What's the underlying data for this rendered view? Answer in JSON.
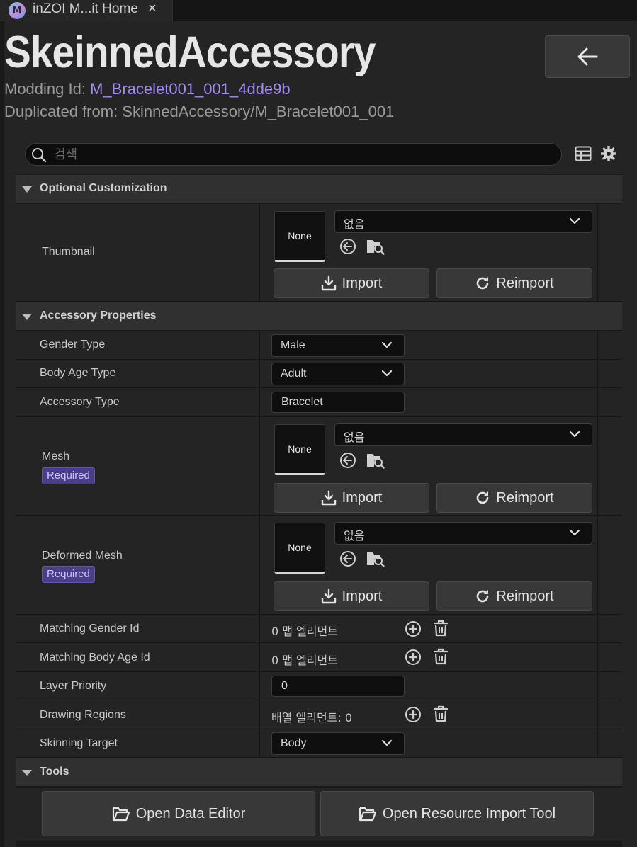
{
  "tab": {
    "title": "inZOI M...it Home",
    "close": "×",
    "logo": "M"
  },
  "header": {
    "title": "SkeinnedAccessory",
    "modding_id_label": "Modding Id: ",
    "modding_id_value": "M_Bracelet001_001_4dde9b",
    "duplicated_from": "Duplicated from: SkinnedAccessory/M_Bracelet001_001"
  },
  "search": {
    "placeholder": "검색",
    "value": ""
  },
  "sections": {
    "optional": "Optional Customization",
    "accessory": "Accessory Properties",
    "tools": "Tools"
  },
  "asset_picker": {
    "thumb_text": "None",
    "dropdown_value": "없음",
    "import_label": "Import",
    "reimport_label": "Reimport"
  },
  "rows": {
    "thumbnail": "Thumbnail",
    "gender_type": {
      "label": "Gender Type",
      "value": "Male"
    },
    "body_age_type": {
      "label": "Body Age Type",
      "value": "Adult"
    },
    "accessory_type": {
      "label": "Accessory Type",
      "value": "Bracelet"
    },
    "mesh": {
      "label": "Mesh",
      "badge": "Required"
    },
    "deformed_mesh": {
      "label": "Deformed Mesh",
      "badge": "Required"
    },
    "matching_gender_id": {
      "label": "Matching Gender Id",
      "value": "0 맵 엘리먼트"
    },
    "matching_body_age_id": {
      "label": "Matching Body Age Id",
      "value": "0 맵 엘리먼트"
    },
    "layer_priority": {
      "label": "Layer Priority",
      "value": "0"
    },
    "drawing_regions": {
      "label": "Drawing Regions",
      "value": "배열 엘리먼트: 0"
    },
    "skinning_target": {
      "label": "Skinning Target",
      "value": "Body"
    }
  },
  "tools": {
    "open_data_editor": "Open Data Editor",
    "open_resource_import_tool": "Open Resource Import Tool"
  },
  "icons": {
    "back": "arrow-left-icon",
    "search": "search-icon",
    "table": "table-icon",
    "settings": "gear-icon",
    "use_selected": "arrow-circle-left-icon",
    "browse": "folder-search-icon",
    "import": "download-icon",
    "reimport": "refresh-icon",
    "add": "plus-circle-icon",
    "delete": "trash-icon",
    "folder": "folder-open-icon"
  },
  "colors": {
    "accent": "#a38cf0",
    "badge_bg": "#4a3d8a",
    "panel_bg": "#242424",
    "section_bg": "#303030"
  }
}
